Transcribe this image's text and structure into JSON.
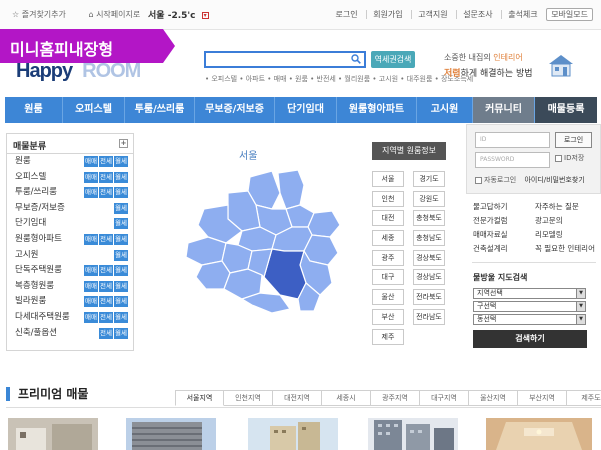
{
  "topbar": {
    "favorites": "즐겨찾기추가",
    "homepage": "시작페이지로",
    "weather_city": "서울",
    "weather_temp": "-2.5'c",
    "links": [
      "로그인",
      "회원가입",
      "고객지원",
      "설문조사",
      "출석체크"
    ],
    "mobile": "모바일모드"
  },
  "banner": "미니홈피내장형",
  "logo": {
    "left": "Happy",
    "right": "ROOM"
  },
  "search": {
    "placeholder": "",
    "button": "역세권검색",
    "keywords": "• 오피스텔 • 아파트 • 매매 • 원룸 • 반전세 • 월리원룸 • 고시원 • 대주원룸 • 장도소득세"
  },
  "ad": {
    "line1_pre": "소중한 내집의 ",
    "line1_hl": "인테리어",
    "line2_hl": "저렴",
    "line2_post": "하게 해결하는 방법"
  },
  "nav": {
    "items": [
      "원룸",
      "오피스텔",
      "투룸/쓰리룸",
      "무보증/저보증",
      "단기임대",
      "원룸형아파트",
      "고시원"
    ],
    "community": "커뮤니티",
    "register": "매물등록"
  },
  "categories": {
    "title": "매물분류",
    "plus": "+",
    "rows": [
      {
        "label": "원룸",
        "tags": [
          "매매",
          "전세",
          "월세"
        ]
      },
      {
        "label": "오피스텔",
        "tags": [
          "매매",
          "전세",
          "월세"
        ]
      },
      {
        "label": "투룸/쓰리룸",
        "tags": [
          "매매",
          "전세",
          "월세"
        ]
      },
      {
        "label": "무보증/저보증",
        "tags": [
          "월세"
        ]
      },
      {
        "label": "단기임대",
        "tags": [
          "월세"
        ]
      },
      {
        "label": "원룸형아파트",
        "tags": [
          "매매",
          "전세",
          "월세"
        ]
      },
      {
        "label": "고시원",
        "tags": [
          "월세"
        ]
      },
      {
        "label": "단독주택원룸",
        "tags": [
          "매매",
          "전세",
          "월세"
        ]
      },
      {
        "label": "복층형원룸",
        "tags": [
          "매매",
          "전세",
          "월세"
        ]
      },
      {
        "label": "빌라원룸",
        "tags": [
          "매매",
          "전세",
          "월세"
        ]
      },
      {
        "label": "다세대주택원룸",
        "tags": [
          "매매",
          "전세",
          "월세"
        ]
      },
      {
        "label": "신축/풀옵션",
        "tags": [
          "전세",
          "월세"
        ]
      }
    ]
  },
  "map": {
    "label": "서울"
  },
  "regions": {
    "title": "지역별 원룸정보",
    "items": [
      "서울",
      "경기도",
      "인천",
      "강원도",
      "대전",
      "충청북도",
      "세종",
      "충청남도",
      "광주",
      "경상북도",
      "대구",
      "경상남도",
      "울산",
      "전라북도",
      "부산",
      "전라남도",
      "제주"
    ]
  },
  "login": {
    "id_placeholder": "ID",
    "pw_placeholder": "PASSWORD",
    "button": "로그인",
    "save_id": "ID저장",
    "auto_login": "자동로그인",
    "find": "아이디/비밀번호찾기"
  },
  "quick_links": [
    "물고답하기",
    "자주하는 질문",
    "전문가컬럼",
    "광고문의",
    "매매자료실",
    "리모델링",
    "건축설계리",
    "꼭 필요한 인테리어"
  ],
  "map_search": {
    "title": "물방울 지도검색",
    "selects": [
      "지역선택",
      "구선택",
      "동선택"
    ],
    "button": "검색하기"
  },
  "premium": {
    "title": "프리미엄 매물",
    "tabs": [
      "서울지역",
      "인천지역",
      "대전지역",
      "세종시",
      "광주지역",
      "대구지역",
      "울산지역",
      "부산지역",
      "제주도"
    ]
  },
  "colors": {
    "nav": "#3d86d6",
    "banner": "#b316c6",
    "map_fill": "#8eaef0",
    "map_selected": "#3d5fc4"
  }
}
